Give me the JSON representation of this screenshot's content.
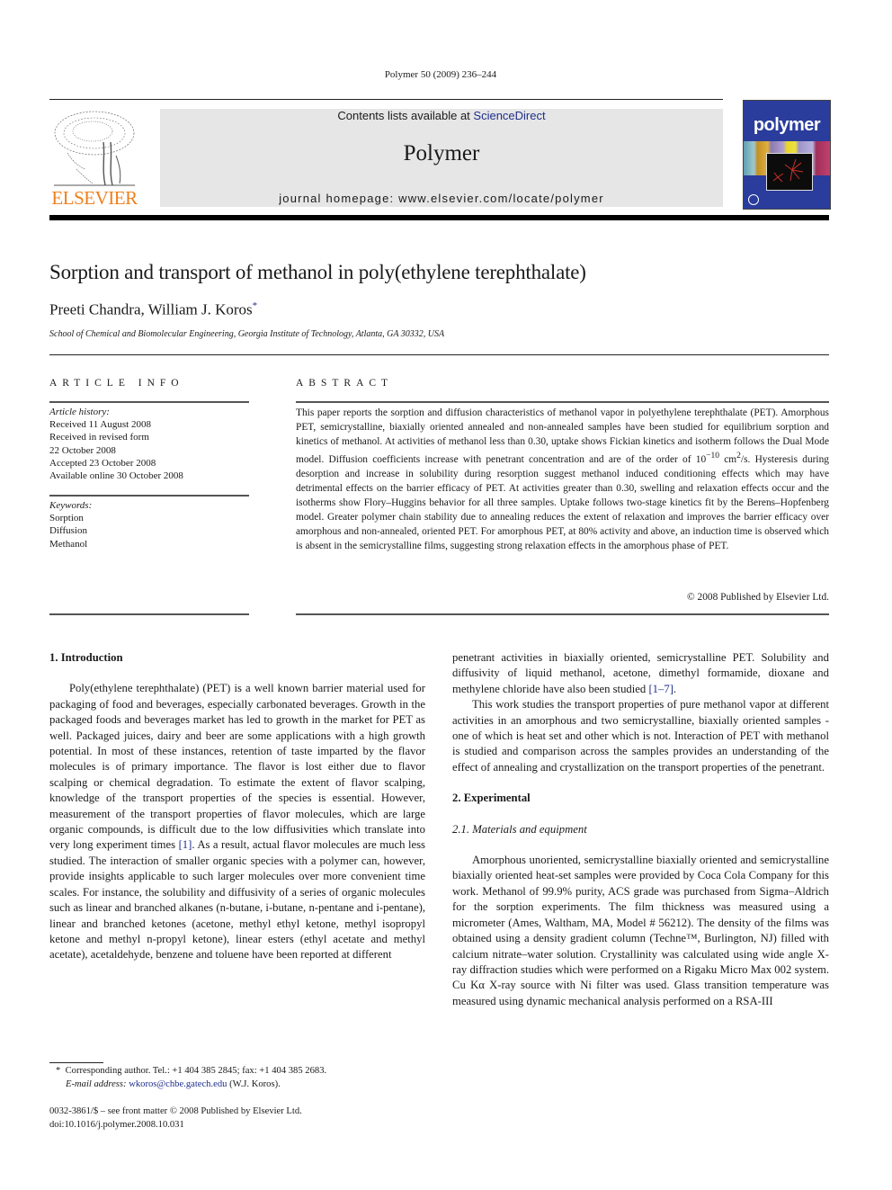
{
  "header": {
    "running_head": "Polymer 50 (2009) 236–244",
    "contents_prefix": "Contents lists available at ",
    "contents_link": "ScienceDirect",
    "journal_name": "Polymer",
    "homepage": "journal homepage: www.elsevier.com/locate/polymer",
    "publisher_logo_text": "ELSEVIER",
    "cover_title": "polymer"
  },
  "colors": {
    "link": "#1f2e8c",
    "elsevier_orange": "#f07f1b",
    "masthead_bg": "#e6e6e6",
    "cover_blue": "#2a3c9c"
  },
  "article": {
    "title": "Sorption and transport of methanol in poly(ethylene terephthalate)",
    "authors": "Preeti Chandra, William J. Koros",
    "author_mark": "*",
    "affiliation": "School of Chemical and Biomolecular Engineering, Georgia Institute of Technology, Atlanta, GA 30332, USA"
  },
  "article_info": {
    "heading": "ARTICLE INFO",
    "history_label": "Article history:",
    "history": [
      "Received 11 August 2008",
      "Received in revised form",
      "22 October 2008",
      "Accepted 23 October 2008",
      "Available online 30 October 2008"
    ],
    "keywords_label": "Keywords:",
    "keywords": [
      "Sorption",
      "Diffusion",
      "Methanol"
    ]
  },
  "abstract": {
    "heading": "ABSTRACT",
    "text_before_exp": "This paper reports the sorption and diffusion characteristics of methanol vapor in polyethylene terephthalate (PET). Amorphous PET, semicrystalline, biaxially oriented annealed and non-annealed samples have been studied for equilibrium sorption and kinetics of methanol. At activities of methanol less than 0.30, uptake shows Fickian kinetics and isotherm follows the Dual Mode model. Diffusion coefficients increase with penetrant concentration and are of the order of 10",
    "exp1": "−10",
    "mid": " cm",
    "exp2": "2",
    "text_after_exp": "/s. Hysteresis during desorption and increase in solubility during resorption suggest methanol induced conditioning effects which may have detrimental effects on the barrier efficacy of PET. At activities greater than 0.30, swelling and relaxation effects occur and the isotherms show Flory–Huggins behavior for all three samples. Uptake follows two-stage kinetics fit by the Berens–Hopfenberg model. Greater polymer chain stability due to annealing reduces the extent of relaxation and improves the barrier efficacy over amorphous and non-annealed, oriented PET. For amorphous PET, at 80% activity and above, an induction time is observed which is absent in the semicrystalline films, suggesting strong relaxation effects in the amorphous phase of PET.",
    "copyright": "© 2008 Published by Elsevier Ltd."
  },
  "body": {
    "intro_heading": "1.  Introduction",
    "intro_p1_a": "Poly(ethylene terephthalate) (PET) is a well known barrier material used for packaging of food and beverages, especially carbonated beverages. Growth in the packaged foods and beverages market has led to growth in the market for PET as well. Packaged juices, dairy and beer are some applications with a high growth potential. In most of these instances, retention of taste imparted by the flavor molecules is of primary importance. The flavor is lost either due to flavor scalping or chemical degradation. To estimate the extent of flavor scalping, knowledge of the transport properties of the species is essential. However, measurement of the transport properties of flavor molecules, which are large organic compounds, is difficult due to the low diffusivities which translate into very long experiment times ",
    "intro_p1_ref": "[1]",
    "intro_p1_b": ". As a result, actual flavor molecules are much less studied. The interaction of smaller organic species with a polymer can, however, provide insights applicable to such larger molecules over more convenient time scales. For instance, the solubility and diffusivity of a series of organic molecules such as linear and branched alkanes (n-butane, i-butane, n-pentane and i-pentane), linear and branched ketones (acetone, methyl ethyl ketone, methyl isopropyl ketone and methyl n-propyl ketone), linear esters (ethyl acetate and methyl acetate), acetaldehyde, benzene and toluene have been reported at different penetrant activities in biaxially oriented, semicrystalline PET. Solubility and diffusivity of liquid methanol, acetone, dimethyl formamide, dioxane and methylene chloride have also been studied ",
    "intro_p1_ref2": "[1–7]",
    "intro_p1_c": ".",
    "intro_p2": "This work studies the transport properties of pure methanol vapor at different activities in an amorphous and two semicrystalline, biaxially oriented samples - one of which is heat set and other which is not. Interaction of PET with methanol is studied and comparison across the samples provides an understanding of the effect of annealing and crystallization on the transport properties of the penetrant.",
    "exp_heading": "2.  Experimental",
    "materials_heading": "2.1.  Materials and equipment",
    "materials_p": "Amorphous unoriented, semicrystalline biaxially oriented and semicrystalline biaxially oriented heat-set samples were provided by Coca Cola Company for this work. Methanol of 99.9% purity, ACS grade was purchased from Sigma–Aldrich for the sorption experiments. The film thickness was measured using a micrometer (Ames, Waltham, MA, Model # 56212). The density of the films was obtained using a density gradient column (Techne™, Burlington, NJ) filled with calcium nitrate–water solution. Crystallinity was calculated using wide angle X-ray diffraction studies which were performed on a Rigaku Micro Max 002 system. Cu Kα X-ray source with Ni filter was used. Glass transition temperature was measured using dynamic mechanical analysis performed on a RSA-III"
  },
  "footnote": {
    "mark": "*",
    "corresponding": "Corresponding author. Tel.: +1 404 385 2845; fax: +1 404 385 2683.",
    "email_label": "E-mail address:",
    "email": "wkoros@chbe.gatech.edu",
    "email_suffix": " (W.J. Koros)."
  },
  "front_matter": {
    "issn_line": "0032-3861/$ – see front matter © 2008 Published by Elsevier Ltd.",
    "doi": "doi:10.1016/j.polymer.2008.10.031"
  }
}
